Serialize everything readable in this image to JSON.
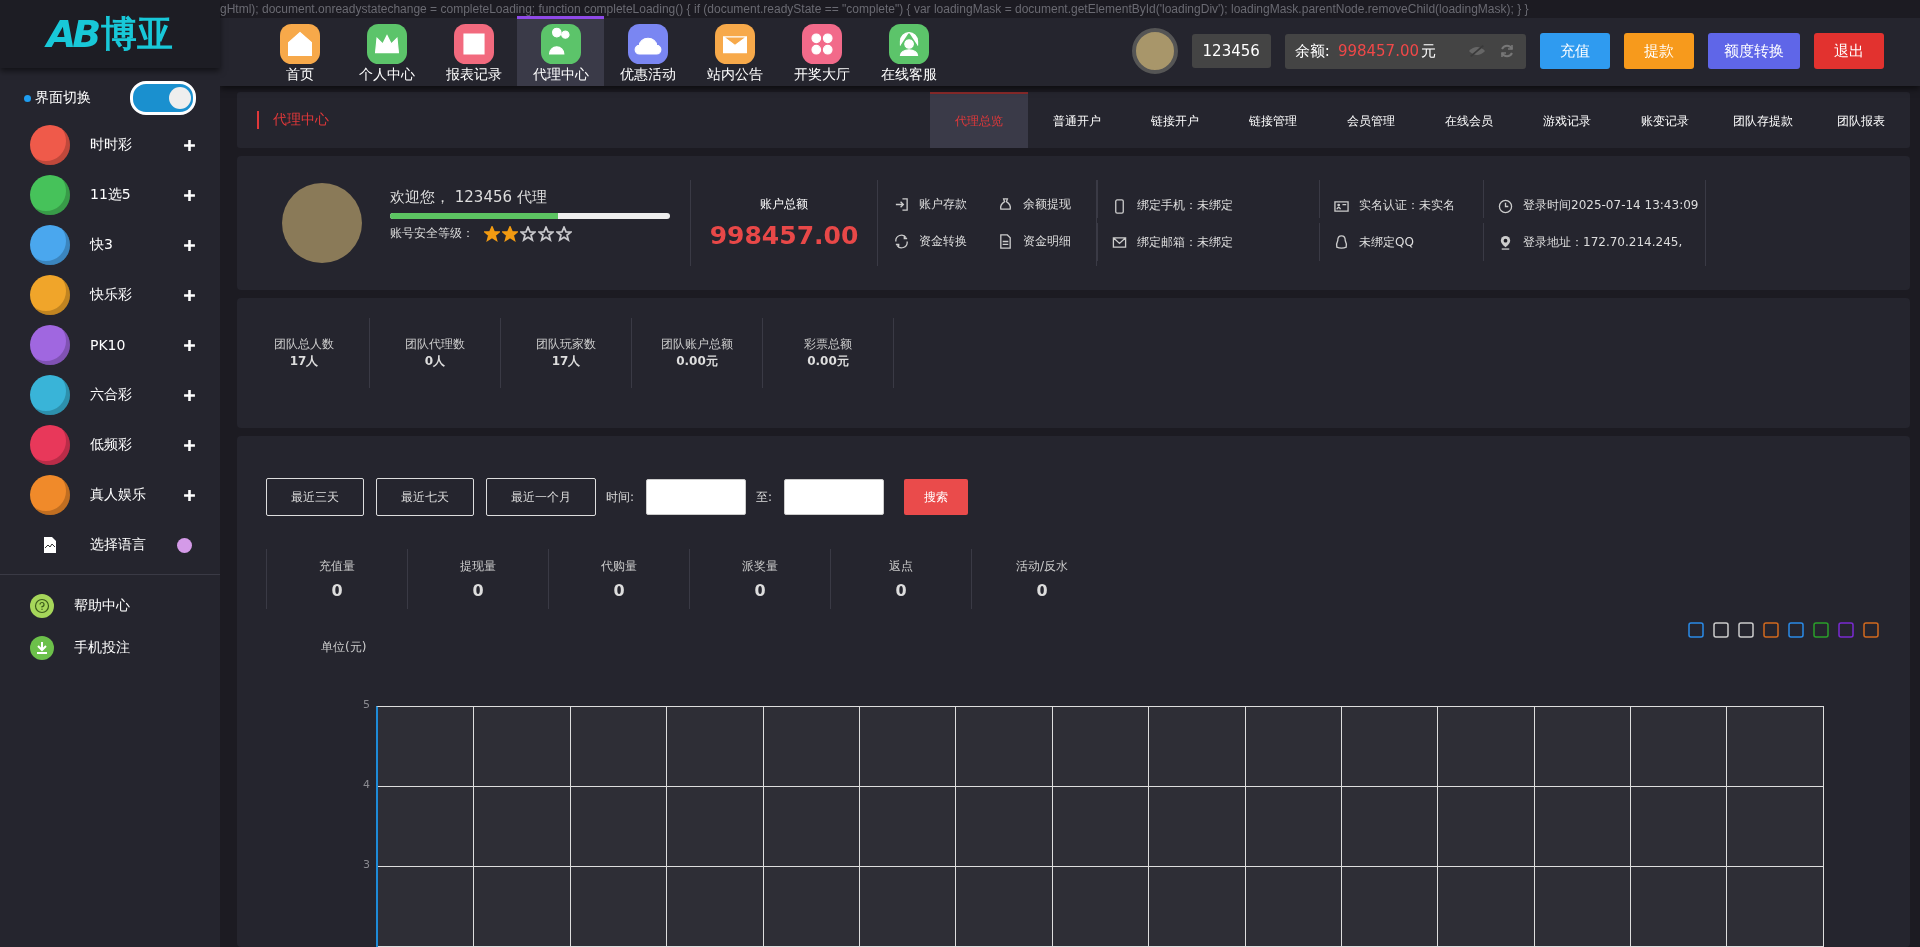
{
  "code_text": "gHtml); document.onreadystatechange = completeLoading; function completeLoading() { if (document.readyState == \"complete\") { var loadingMask = document.getElementById('loadingDiv'); loadingMask.parentNode.removeChild(loadingMask); } }",
  "logo": {
    "letters": "AB",
    "name": "博亚"
  },
  "nav": [
    {
      "label": "首页",
      "kind": "home",
      "color": "#f7a94a",
      "selected": false
    },
    {
      "label": "个人中心",
      "kind": "crown",
      "color": "#5cc46a",
      "selected": false
    },
    {
      "label": "报表记录",
      "kind": "report",
      "color": "#f26a7e",
      "selected": false
    },
    {
      "label": "代理中心",
      "kind": "agent",
      "color": "#5cc46a",
      "selected": true
    },
    {
      "label": "优惠活动",
      "kind": "gift",
      "color": "#7a86f2",
      "selected": false
    },
    {
      "label": "站内公告",
      "kind": "mail",
      "color": "#f7a94a",
      "selected": false
    },
    {
      "label": "开奖大厅",
      "kind": "grid",
      "color": "#f26a8a",
      "selected": false
    },
    {
      "label": "在线客服",
      "kind": "support",
      "color": "#5cc46a",
      "selected": false
    }
  ],
  "user": {
    "username": "123456",
    "balance_label": "余额:",
    "balance_value": "998457.00",
    "balance_unit": "元"
  },
  "top_buttons": [
    {
      "label": "充值",
      "color": "#2f9bf0"
    },
    {
      "label": "提款",
      "color": "#f79a1c"
    },
    {
      "label": "额度转换",
      "color": "#5f66e8"
    },
    {
      "label": "退出",
      "color": "#e2322f"
    }
  ],
  "sidebar": {
    "theme_switch": {
      "label": "界面切换",
      "on": true
    },
    "games": [
      {
        "label": "时时彩",
        "color": "#ef5a4a",
        "kind": "game"
      },
      {
        "label": "11选5",
        "color": "#46c25a",
        "kind": "game"
      },
      {
        "label": "快3",
        "color": "#4aa7ee",
        "kind": "game"
      },
      {
        "label": "快乐彩",
        "color": "#f0a52a",
        "kind": "game"
      },
      {
        "label": "PK10",
        "color": "#a067e0",
        "kind": "game"
      },
      {
        "label": "六合彩",
        "color": "#39b4d8",
        "kind": "game"
      },
      {
        "label": "低频彩",
        "color": "#e8385a",
        "kind": "game"
      },
      {
        "label": "真人娱乐",
        "color": "#f08a2a",
        "kind": "game"
      },
      {
        "label": "选择语言",
        "color": "#d49ae8",
        "kind": "language"
      }
    ],
    "help": [
      {
        "label": "帮助中心",
        "kind": "help"
      },
      {
        "label": "手机投注",
        "kind": "download"
      }
    ]
  },
  "section_title": "代理中心",
  "sub_tabs": [
    {
      "label": "代理总览",
      "selected": true
    },
    {
      "label": "普通开户",
      "selected": false
    },
    {
      "label": "链接开户",
      "selected": false
    },
    {
      "label": "链接管理",
      "selected": false
    },
    {
      "label": "会员管理",
      "selected": false
    },
    {
      "label": "在线会员",
      "selected": false
    },
    {
      "label": "游戏记录",
      "selected": false
    },
    {
      "label": "账变记录",
      "selected": false
    },
    {
      "label": "团队存提款",
      "selected": false
    },
    {
      "label": "团队报表",
      "selected": false
    }
  ],
  "profile": {
    "welcome": "欢迎您， 123456 代理",
    "security": {
      "level": 0.6,
      "label": "账号安全等级：",
      "stars": 2
    },
    "total_label": "账户总额",
    "total": "998457.00",
    "actions": [
      {
        "label": "账户存款",
        "kind": "deposit"
      },
      {
        "label": "余额提现",
        "kind": "withdraw"
      },
      {
        "label": "资金转换",
        "kind": "transfer"
      },
      {
        "label": "资金明细",
        "kind": "detail"
      }
    ],
    "info": [
      {
        "label": "绑定手机：未绑定",
        "kind": "phone"
      },
      {
        "label": "绑定邮箱：未绑定",
        "kind": "mail"
      },
      {
        "label": "实名认证：未实名",
        "kind": "id"
      },
      {
        "label": "未绑定QQ",
        "kind": "qq"
      },
      {
        "label": "登录时间2025-07-14 13:43:09",
        "kind": "clock"
      },
      {
        "label": "登录地址：172.70.214.245,",
        "kind": "pin"
      }
    ]
  },
  "team_stats": [
    {
      "label": "团队总人数",
      "value": "17人"
    },
    {
      "label": "团队代理数",
      "value": "0人"
    },
    {
      "label": "团队玩家数",
      "value": "17人"
    },
    {
      "label": "团队账户总额",
      "value": "0.00元"
    },
    {
      "label": "彩票总额",
      "value": "0.00元"
    }
  ],
  "filter": {
    "quick": [
      "最近三天",
      "最近七天",
      "最近一个月"
    ],
    "time_label": "时间:",
    "to_label": "至:",
    "search": "搜索"
  },
  "report_stats": [
    {
      "label": "充值量",
      "value": "0"
    },
    {
      "label": "提现量",
      "value": "0"
    },
    {
      "label": "代购量",
      "value": "0"
    },
    {
      "label": "派奖量",
      "value": "0"
    },
    {
      "label": "返点",
      "value": "0"
    },
    {
      "label": "活动/反水",
      "value": "0"
    }
  ],
  "chart": {
    "unit_label": "单位(元)",
    "y_ticks": [
      "5",
      "4",
      "3"
    ]
  }
}
